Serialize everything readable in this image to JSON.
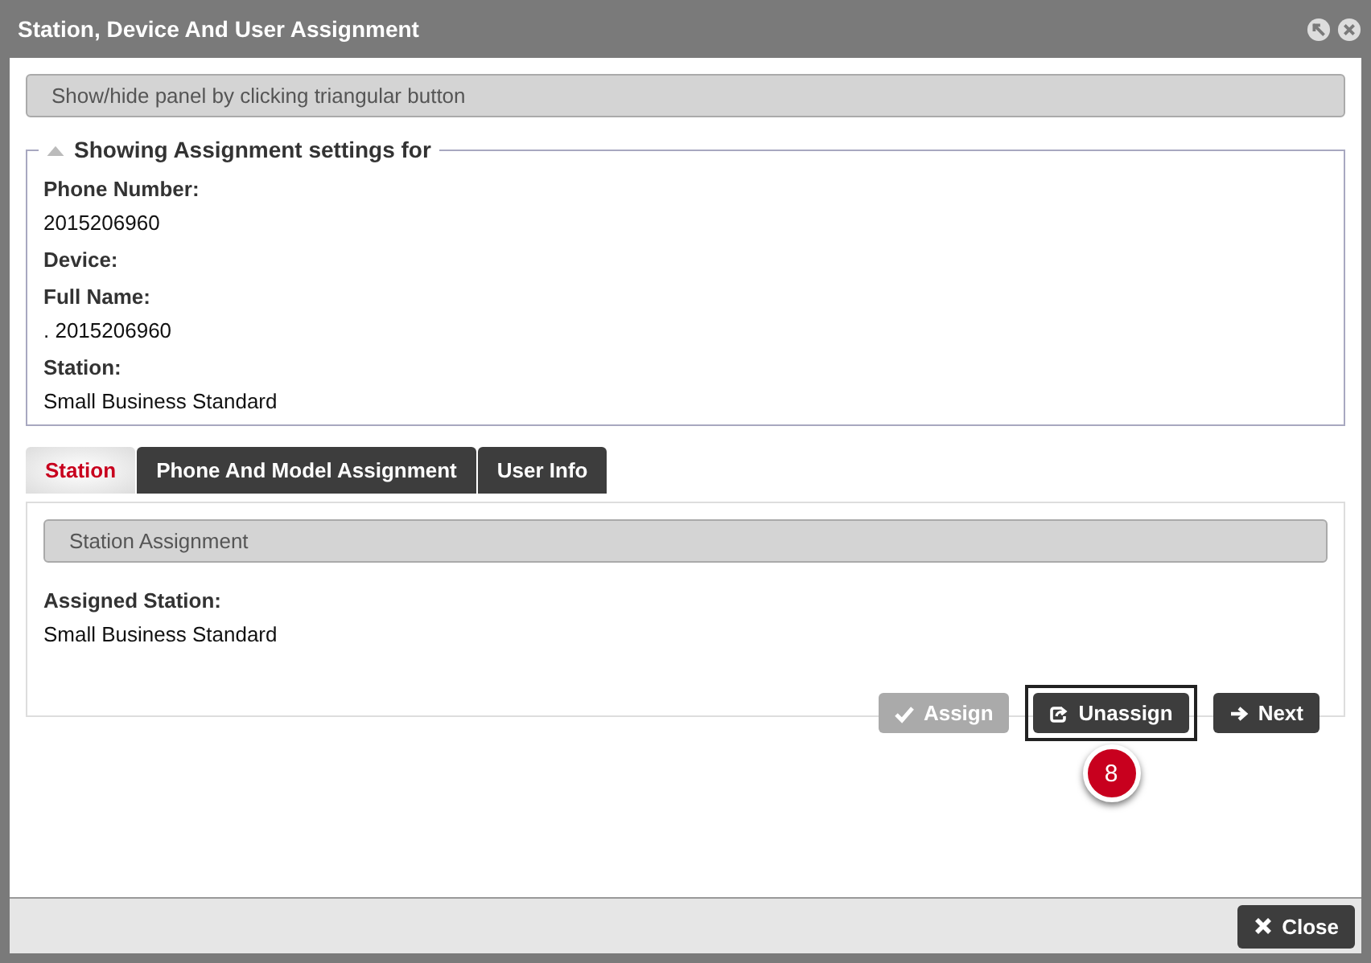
{
  "window": {
    "title": "Station, Device And User Assignment"
  },
  "panel_toggle": "Show/hide panel by clicking triangular button",
  "settings": {
    "legend": "Showing Assignment settings for",
    "expanded": true,
    "fields": [
      {
        "label": "Phone Number:",
        "value": "2015206960"
      },
      {
        "label": "Device:"
      },
      {
        "label": "Full Name:",
        "value": ". 2015206960"
      },
      {
        "label": "Station:",
        "value": "Small Business Standard"
      }
    ]
  },
  "tabs": [
    {
      "label": "Station",
      "selected": true
    },
    {
      "label": "Phone And Model Assignment",
      "selected": false
    },
    {
      "label": "User Info",
      "selected": false
    }
  ],
  "station_panel": {
    "header": "Station Assignment",
    "label": "Assigned Station:",
    "value": "Small Business Standard"
  },
  "buttons": [
    {
      "label": "Assign",
      "kind": "check",
      "disabled": true,
      "highlighted": false
    },
    {
      "label": "Unassign",
      "kind": "unassign",
      "disabled": false,
      "highlighted": true,
      "callout": "8"
    },
    {
      "label": "Next",
      "kind": "arrow",
      "disabled": false,
      "highlighted": false
    }
  ],
  "footer": {
    "close": "Close"
  }
}
